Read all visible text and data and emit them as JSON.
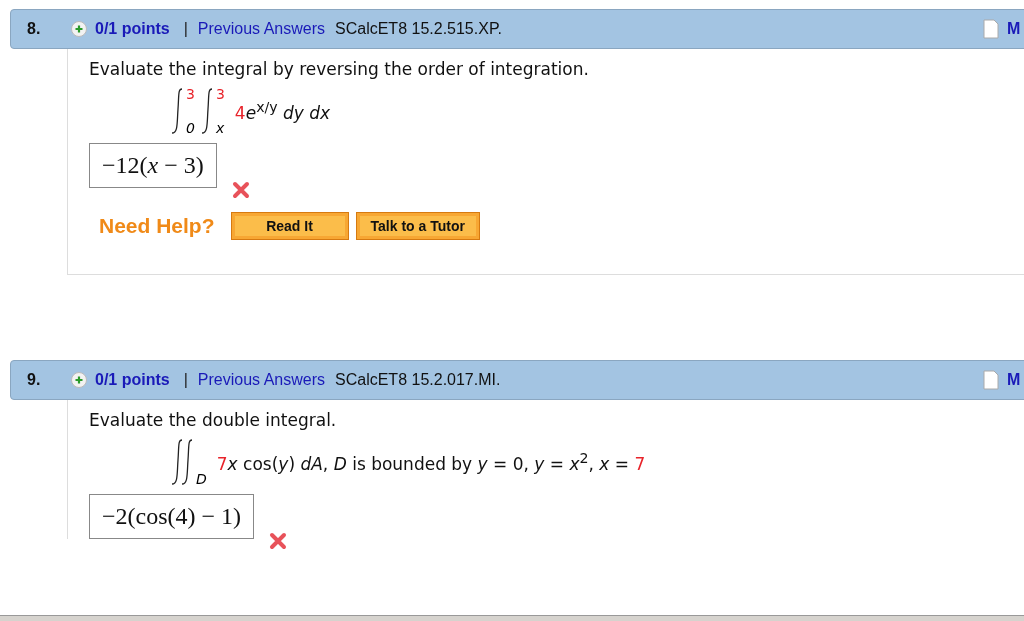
{
  "questions": [
    {
      "number": "8.",
      "points": "0/1 points",
      "separator": "|",
      "history_link": "Previous Answers",
      "code": "SCalcET8 15.2.515.XP.",
      "header_letter": "M",
      "prompt": "Evaluate the integral by reversing the order of integration.",
      "integrals": [
        {
          "upper": "3",
          "lower": "0",
          "double": false
        },
        {
          "upper": "3",
          "lower": "x",
          "double": false
        }
      ],
      "integrand": [
        {
          "text": "4",
          "highlight": true
        },
        {
          "text": "*e*$^{x/y}$ *dy dx*",
          "highlight": false
        }
      ],
      "answer": "−12(*x* − 3)",
      "correct": false,
      "help": {
        "label": "Need Help?",
        "buttons": [
          "Read It",
          "Talk to a Tutor"
        ]
      }
    },
    {
      "number": "9.",
      "points": "0/1 points",
      "separator": "|",
      "history_link": "Previous Answers",
      "code": "SCalcET8 15.2.017.MI.",
      "header_letter": "M",
      "prompt": "Evaluate the double integral.",
      "integrals": [
        {
          "lower": "D",
          "double": true
        }
      ],
      "integrand": [
        {
          "text": "7",
          "highlight": true
        },
        {
          "text": "*x* cos(*y*) *dA*, *D* is bounded by *y* = 0, *y* = *x*$^{2}$, *x* = ",
          "highlight": false
        },
        {
          "text": "7",
          "highlight": true
        }
      ],
      "answer": "−2(cos(4) − 1)",
      "correct": false
    }
  ]
}
